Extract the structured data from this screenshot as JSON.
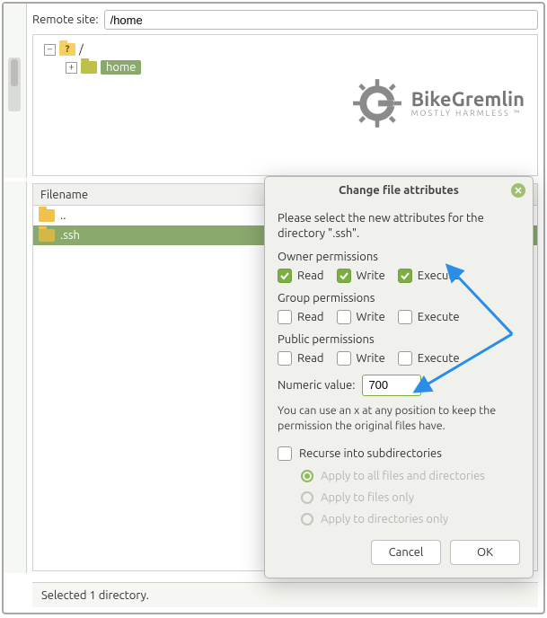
{
  "remote": {
    "label": "Remote site:",
    "path": "/home"
  },
  "tree": {
    "root_label": "/",
    "child_label": "home",
    "root_expander": "−",
    "child_expander": "+"
  },
  "logo": {
    "brand": "BikeGremlin",
    "tagline": "MOSTLY HARMLESS ™"
  },
  "filelist": {
    "header": "Filename",
    "rows": [
      {
        "name": "..",
        "selected": false
      },
      {
        "name": ".ssh",
        "selected": true
      }
    ]
  },
  "statusbar": "Selected 1 directory.",
  "dialog": {
    "title": "Change file attributes",
    "intro": "Please select the new attributes for the directory \".ssh\".",
    "groups": {
      "owner": {
        "title": "Owner permissions",
        "read": true,
        "write": true,
        "execute": true
      },
      "group": {
        "title": "Group permissions",
        "read": false,
        "write": false,
        "execute": false
      },
      "public": {
        "title": "Public permissions",
        "read": false,
        "write": false,
        "execute": false
      }
    },
    "labels": {
      "read": "Read",
      "write": "Write",
      "execute": "Execute"
    },
    "numeric_label": "Numeric value:",
    "numeric_value": "700",
    "hint": "You can use an x at any position to keep the permission the original files have.",
    "recurse_label": "Recurse into subdirectories",
    "recurse_checked": false,
    "radios": {
      "all": "Apply to all files and directories",
      "files": "Apply to files only",
      "dirs": "Apply to directories only",
      "selected": "all"
    },
    "buttons": {
      "cancel": "Cancel",
      "ok": "OK"
    }
  },
  "chart_data": null
}
